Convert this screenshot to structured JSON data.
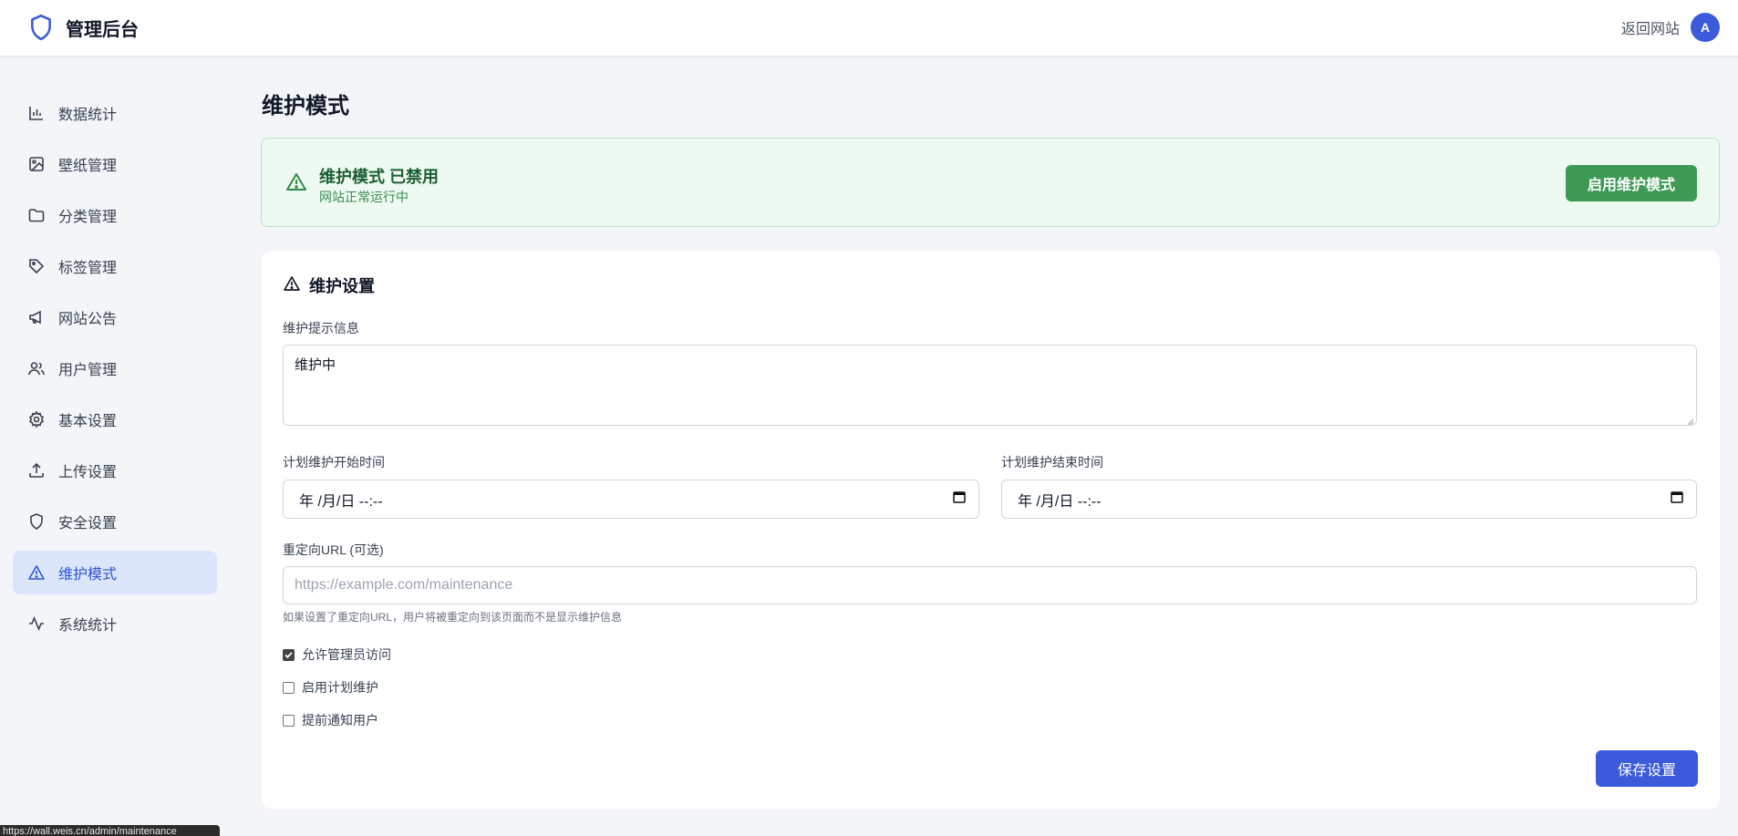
{
  "header": {
    "title": "管理后台",
    "back_link": "返回网站",
    "avatar_initial": "A",
    "brand_icon": "shield-icon"
  },
  "sidebar": {
    "items": [
      {
        "label": "数据统计",
        "icon": "bar-chart-icon",
        "active": false
      },
      {
        "label": "壁纸管理",
        "icon": "image-icon",
        "active": false
      },
      {
        "label": "分类管理",
        "icon": "folder-icon",
        "active": false
      },
      {
        "label": "标签管理",
        "icon": "tag-icon",
        "active": false
      },
      {
        "label": "网站公告",
        "icon": "megaphone-icon",
        "active": false
      },
      {
        "label": "用户管理",
        "icon": "users-icon",
        "active": false
      },
      {
        "label": "基本设置",
        "icon": "gear-icon",
        "active": false
      },
      {
        "label": "上传设置",
        "icon": "upload-icon",
        "active": false
      },
      {
        "label": "安全设置",
        "icon": "shield-icon",
        "active": false
      },
      {
        "label": "维护模式",
        "icon": "warning-icon",
        "active": true
      },
      {
        "label": "系统统计",
        "icon": "activity-icon",
        "active": false
      }
    ]
  },
  "main": {
    "page_title": "维护模式",
    "status": {
      "title": "维护模式 已禁用",
      "subtitle": "网站正常运行中",
      "button": "启用维护模式"
    },
    "settings": {
      "header": "维护设置",
      "message_label": "维护提示信息",
      "message_value": "维护中",
      "start_label": "计划维护开始时间",
      "start_value": "年 /月/日 --:--",
      "end_label": "计划维护结束时间",
      "end_value": "年 /月/日 --:--",
      "url_label": "重定向URL (可选)",
      "url_placeholder": "https://example.com/maintenance",
      "url_hint": "如果设置了重定向URL，用户将被重定向到该页面而不是显示维护信息",
      "checkboxes": [
        {
          "label": "允许管理员访问",
          "checked": true
        },
        {
          "label": "启用计划维护",
          "checked": false
        },
        {
          "label": "提前通知用户",
          "checked": false
        }
      ],
      "save_button": "保存设置"
    }
  },
  "status_bar": {
    "url": "https://wall.weis.cn/admin/maintenance"
  },
  "colors": {
    "accent": "#3b5bdb",
    "success": "#3f9a55",
    "active_nav_bg": "#dbe6fb"
  }
}
